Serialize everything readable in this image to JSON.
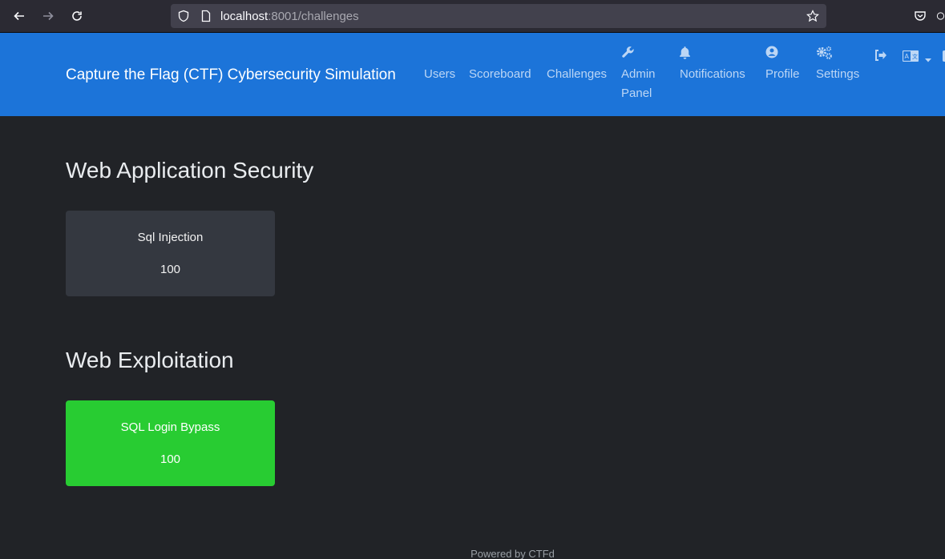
{
  "browser": {
    "url_host": "localhost",
    "url_rest": ":8001/challenges"
  },
  "navbar": {
    "brand": "Capture the Flag (CTF) Cybersecurity Simulation",
    "users": "Users",
    "scoreboard": "Scoreboard",
    "challenges": "Challenges",
    "admin_line1": "Admin",
    "admin_line2": "Panel",
    "notifications": "Notifications",
    "profile": "Profile",
    "settings": "Settings"
  },
  "categories": [
    {
      "title": "Web Application Security",
      "challenges": [
        {
          "name": "Sql Injection",
          "value": "100",
          "solved": false
        }
      ]
    },
    {
      "title": "Web Exploitation",
      "challenges": [
        {
          "name": "SQL Login Bypass",
          "value": "100",
          "solved": true
        }
      ]
    }
  ],
  "footer": {
    "text": "Powered by CTFd"
  },
  "colors": {
    "navbar": "#1c74d9",
    "background": "#212327",
    "solved": "#28cc32",
    "unsolved": "#343840"
  }
}
